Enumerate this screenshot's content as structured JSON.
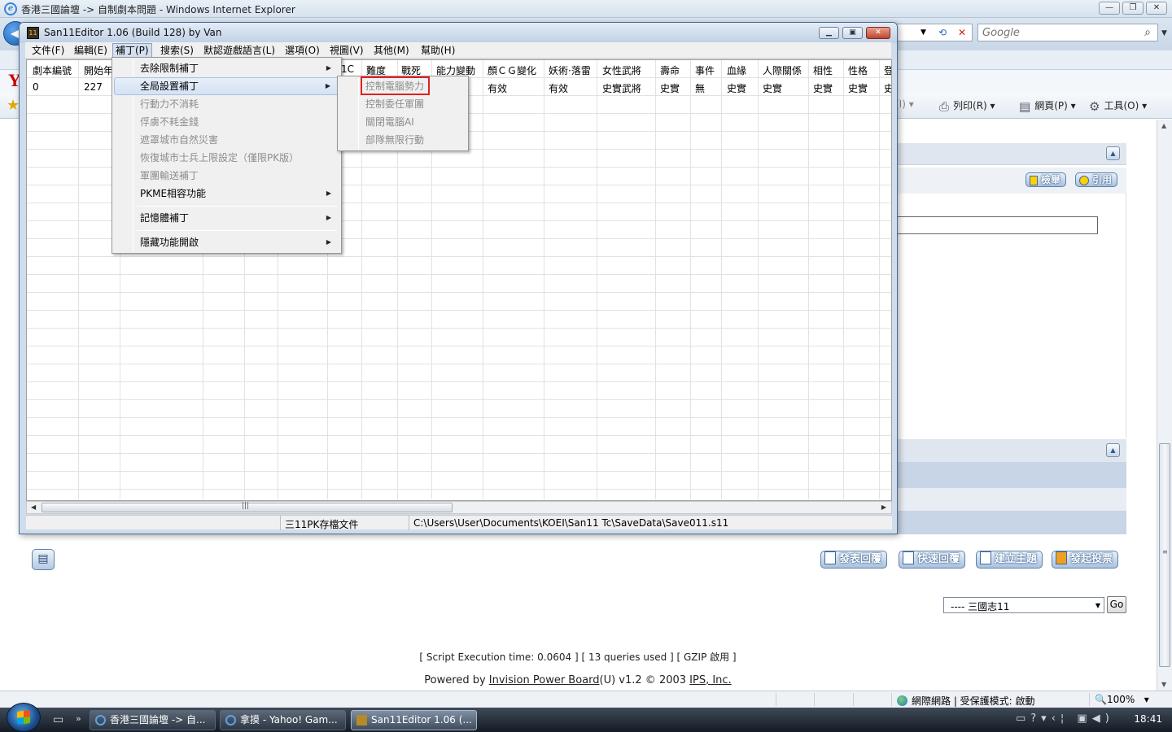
{
  "ie": {
    "title": "香港三國論壇 -> 自制劇本問題 - Windows Internet Explorer",
    "search_placeholder": "Google",
    "commands": {
      "print": "列印(R)",
      "page": "網頁(P)",
      "tools": "工具(O)",
      "partial": "(I)"
    },
    "status": {
      "zone": "網際網路 | 受保護模式: 啟動",
      "zoom": "100%"
    }
  },
  "page": {
    "buttons": {
      "search": "檢舉",
      "quote": "引用",
      "reply": "發表回覆",
      "quick_reply": "快速回覆",
      "new_topic": "建立主題",
      "poll": "發起投票"
    },
    "forum_select": "---- 三國志11",
    "go": "Go",
    "exec_info": "[ Script Execution time: 0.0604 ]  [ 13 queries used ]  [ GZIP 啟用 ]",
    "powered_prefix": "Powered by ",
    "powered_link": "Invision Power Board",
    "powered_mid": "(U) v1.2 © 2003  ",
    "powered_company": "IPS, Inc."
  },
  "editor": {
    "title": "San11Editor 1.06 (Build 128) by Van",
    "icon_text": "11",
    "menu": [
      "文件(F)",
      "編輯(E)",
      "補丁(P)",
      "搜索(S)",
      "默認遊戲語言(L)",
      "選項(O)",
      "視圖(V)",
      "其他(M)",
      "幫助(H)"
    ],
    "columns": [
      "劇本編號",
      "開始年",
      "1C",
      "難度",
      "戰死",
      "能力變動",
      "顏ＣＧ變化",
      "妖術·落雷",
      "女性武將",
      "壽命",
      "事件",
      "血緣",
      "人際關係",
      "相性",
      "性格",
      "登"
    ],
    "row": [
      "0",
      "227",
      "",
      "",
      "",
      "",
      "有效",
      "有效",
      "史實武將",
      "史實",
      "無",
      "史實",
      "史實",
      "史實",
      "史實",
      "史"
    ],
    "status_type": "三11PK存檔文件",
    "status_path": "C:\\Users\\User\\Documents\\KOEI\\San11 Tc\\SaveData\\Save011.s11"
  },
  "patch_menu": {
    "items": [
      {
        "label": "去除限制補丁",
        "enabled": true,
        "submenu": true
      },
      {
        "label": "全局設置補丁",
        "enabled": true,
        "submenu": true,
        "highlighted": true
      },
      {
        "label": "行動力不消耗",
        "enabled": false
      },
      {
        "label": "俘虜不耗金錢",
        "enabled": false
      },
      {
        "label": "遮罩城市自然災害",
        "enabled": false
      },
      {
        "label": "恢復城市士兵上限設定（僅限PK版）",
        "enabled": false
      },
      {
        "label": "軍團輸送補丁",
        "enabled": false
      },
      {
        "label": "PKME相容功能",
        "enabled": true,
        "submenu": true
      },
      {
        "label": "記憶體補丁",
        "enabled": true,
        "submenu": true
      },
      {
        "label": "隱藏功能開啟",
        "enabled": true,
        "submenu": true
      }
    ],
    "submenu": [
      "控制電腦勢力",
      "控制委任軍團",
      "關閉電腦AI",
      "部隊無限行動"
    ]
  },
  "taskbar": {
    "tasks": [
      "香港三國論壇 -> 自...",
      "拿摸 - Yahoo! Gam...",
      "San11Editor 1.06 (..."
    ],
    "clock": "18:41"
  }
}
